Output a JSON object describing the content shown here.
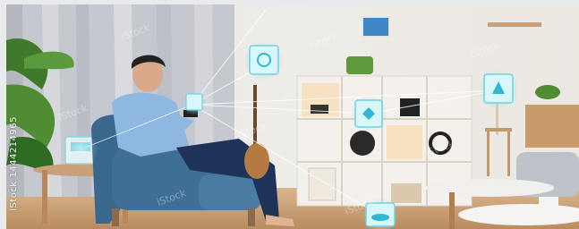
{
  "image": {
    "subject": "smart-home-scene",
    "side_caption": "iStock 1444214965",
    "watermark_text": "iStock",
    "colors": {
      "wall": "#eceae6",
      "curtain": "#c9cbd0",
      "armchair": "#3f6f96",
      "floor": "#c49a6c",
      "shelf": "#f2efe9",
      "accent_light": "#bde9f0"
    },
    "smart_icons": [
      {
        "id": "hub",
        "icon": "smart-hub-icon"
      },
      {
        "id": "speaker",
        "icon": "smart-speaker-icon"
      },
      {
        "id": "lamp",
        "icon": "smart-lamp-icon"
      },
      {
        "id": "phone",
        "icon": "smartphone-icon"
      },
      {
        "id": "shelf",
        "icon": "smart-shelf-device-icon"
      },
      {
        "id": "floor-lamp",
        "icon": "floor-lamp-icon"
      },
      {
        "id": "robot",
        "icon": "robot-vacuum-icon"
      }
    ]
  }
}
